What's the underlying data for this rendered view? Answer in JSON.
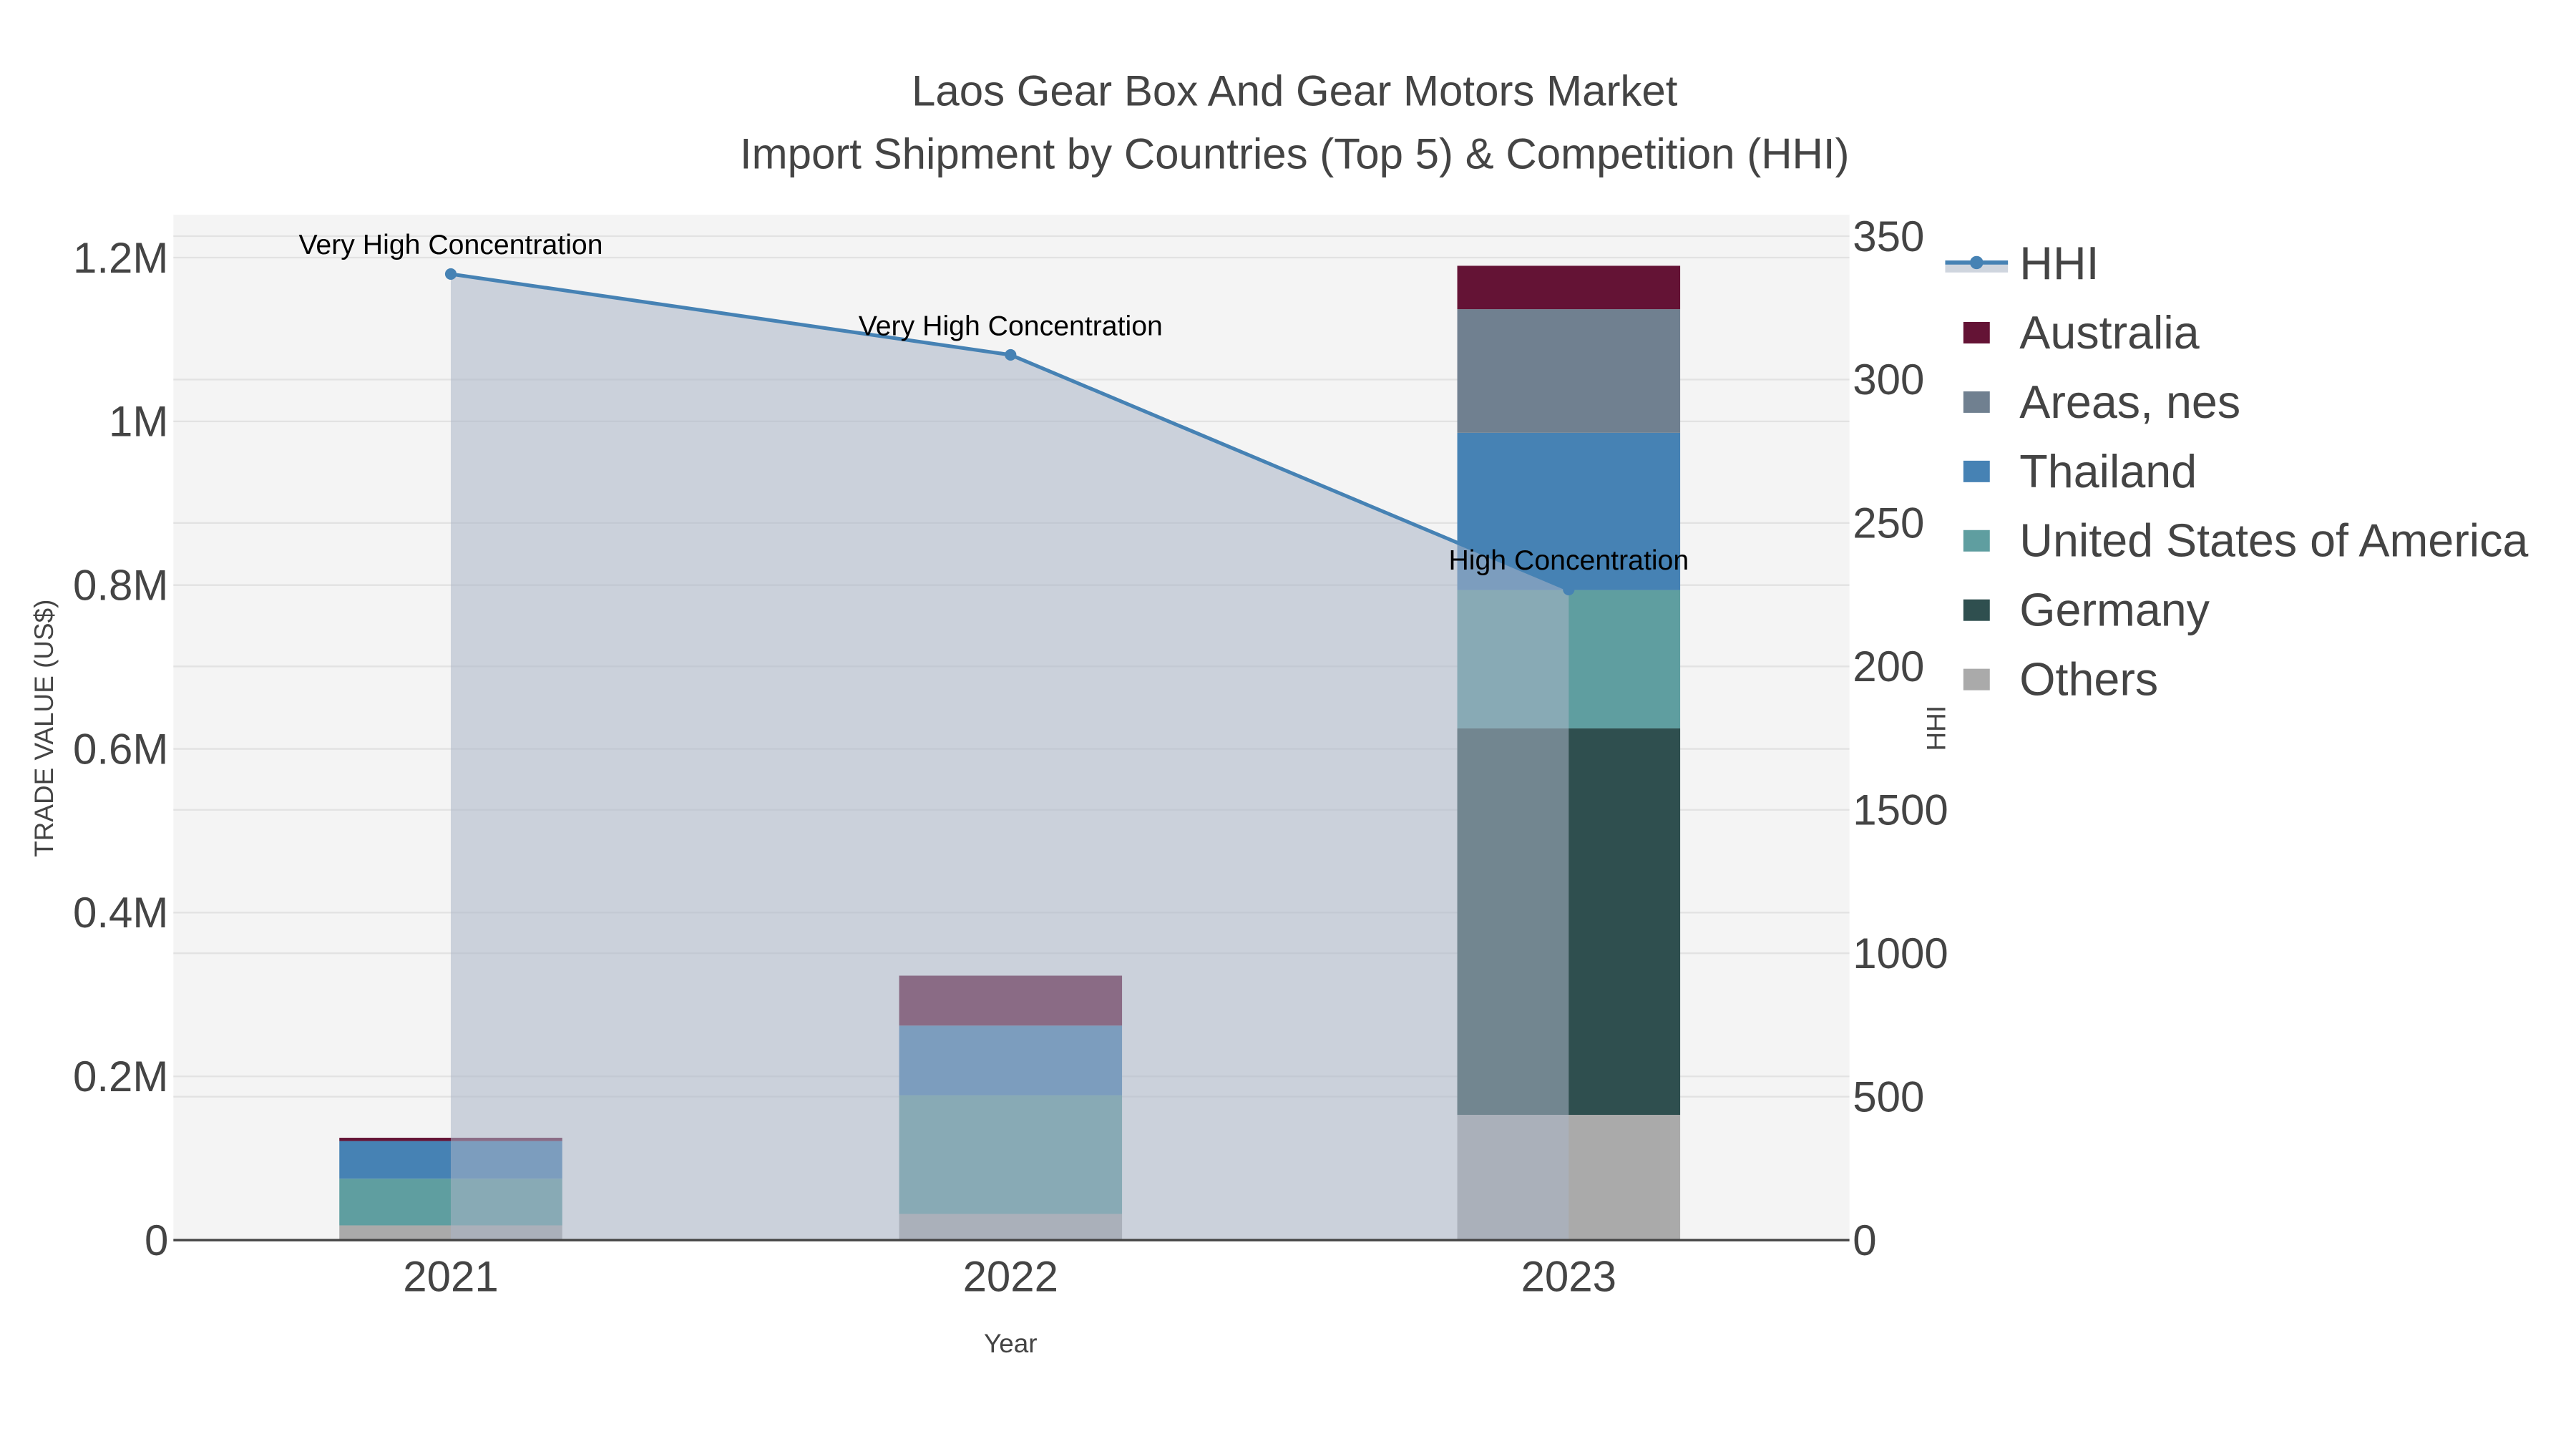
{
  "chart_data": {
    "type": "bar",
    "title": "Laos Gear Box And Gear Motors Market",
    "subtitle": "Import Shipment by Countries (Top 5) & Competition (HHI)",
    "xlabel": "Year",
    "ylabel": "TRADE VALUE (US$)",
    "y2label": "HHI",
    "categories": [
      "2021",
      "2022",
      "2023"
    ],
    "ylim": [
      0,
      1250000
    ],
    "y2lim": [
      0,
      3500
    ],
    "yticks": [
      {
        "v": 0,
        "label": "0"
      },
      {
        "v": 200000,
        "label": "0.2M"
      },
      {
        "v": 400000,
        "label": "0.4M"
      },
      {
        "v": 600000,
        "label": "0.6M"
      },
      {
        "v": 800000,
        "label": "0.8M"
      },
      {
        "v": 1000000,
        "label": "1M"
      },
      {
        "v": 1200000,
        "label": "1.2M"
      }
    ],
    "y2ticks": [
      {
        "v": 0,
        "label": "0"
      },
      {
        "v": 500,
        "label": "500"
      },
      {
        "v": 1000,
        "label": "1000"
      },
      {
        "v": 1500,
        "label": "1500"
      },
      {
        "v": 2000,
        "label": "200"
      },
      {
        "v": 2500,
        "label": "250"
      },
      {
        "v": 3000,
        "label": "300"
      },
      {
        "v": 3500,
        "label": "350"
      }
    ],
    "grid": true,
    "legend_position": "right",
    "series": [
      {
        "name": "Others",
        "color": "#aaaaaa",
        "values": [
          18000,
          32000,
          153000
        ]
      },
      {
        "name": "Germany",
        "color": "#2f4f4f",
        "values": [
          0,
          0,
          472000
        ]
      },
      {
        "name": "United States of America",
        "color": "#5f9ea0",
        "values": [
          57000,
          145000,
          169000
        ]
      },
      {
        "name": "Thailand",
        "color": "#4682b4",
        "values": [
          46000,
          85000,
          192000
        ]
      },
      {
        "name": "Areas, nes",
        "color": "#708090",
        "values": [
          0,
          0,
          151000
        ]
      },
      {
        "name": "Australia",
        "color": "#641335",
        "values": [
          4000,
          61000,
          53000
        ]
      }
    ],
    "hhi": {
      "name": "HHI",
      "color": "#4682b4",
      "values": [
        3368,
        3086,
        2268
      ],
      "annotations": [
        "Very High Concentration",
        "Very High Concentration",
        "High Concentration"
      ]
    },
    "legend_order": [
      "HHI",
      "Australia",
      "Areas, nes",
      "Thailand",
      "United States of America",
      "Germany",
      "Others"
    ]
  }
}
